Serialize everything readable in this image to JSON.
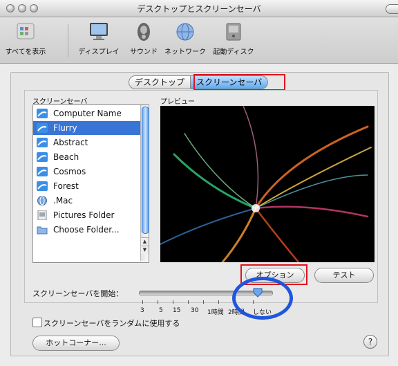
{
  "window": {
    "title": "デスクトップとスクリーンセーバ"
  },
  "toolbar": {
    "items": [
      {
        "label": "すべてを表示",
        "icon": "grid-icon"
      },
      {
        "label": "ディスプレイ",
        "icon": "display-icon"
      },
      {
        "label": "サウンド",
        "icon": "speaker-icon"
      },
      {
        "label": "ネットワーク",
        "icon": "globe-icon"
      },
      {
        "label": "起動ディスク",
        "icon": "disk-icon"
      }
    ]
  },
  "tabs": {
    "desktop": "デスクトップ",
    "screensaver": "スクリーンセーバ"
  },
  "saver_list": {
    "label": "スクリーンセーバ",
    "items": [
      "Computer Name",
      "Flurry",
      "Abstract",
      "Beach",
      "Cosmos",
      "Forest",
      ".Mac",
      "Pictures Folder",
      "Choose Folder..."
    ],
    "selected": "Flurry"
  },
  "preview": {
    "label": "プレビュー"
  },
  "buttons": {
    "options": "オプション",
    "test": "テスト",
    "hot_corners": "ホットコーナー..."
  },
  "start": {
    "label": "スクリーンセーバを開始：",
    "ticks": [
      "3",
      "5",
      "15",
      "30",
      "1時間",
      "2時間",
      "しない"
    ],
    "value": "しない"
  },
  "random": {
    "label": "スクリーンセーバをランダムに使用する",
    "checked": false
  },
  "help": {
    "label": "?"
  },
  "colors": {
    "selection": "#3975d6",
    "highlight": "#e0131d",
    "annotation": "#1f56de"
  }
}
